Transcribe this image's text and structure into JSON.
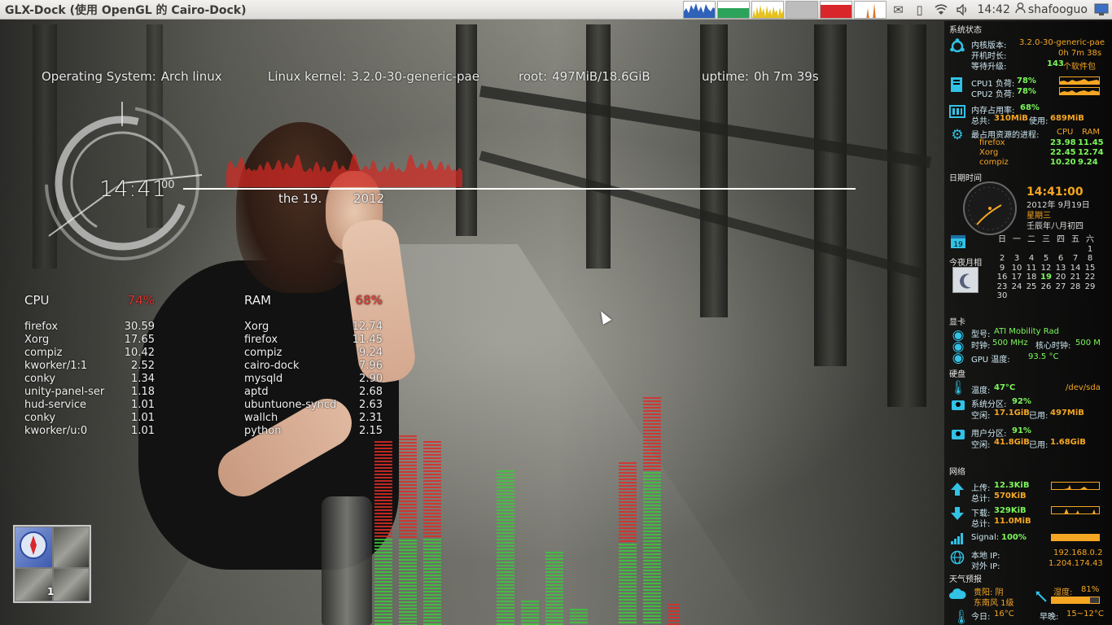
{
  "panel": {
    "title": "GLX-Dock (使用 OpenGL 的 Cairo-Dock)",
    "clock": "14:42",
    "user": "shafooguo"
  },
  "info": {
    "os_label": "Operating System:",
    "os_value": "Arch linux",
    "kernel_label": "Linux kernel:",
    "kernel_value": "3.2.0-30-generic-pae",
    "root_label": "root:",
    "root_value": "497MiB/18.6GiB",
    "uptime_label": "uptime:",
    "uptime_value": "0h 7m 39s"
  },
  "clock_widget": {
    "time": "14:41",
    "seconds": "00",
    "date": "the 19.",
    "year": "2012"
  },
  "cpu_table": {
    "title": "CPU",
    "percent": "74%",
    "rows": [
      {
        "name": "firefox",
        "value": "30.59"
      },
      {
        "name": "Xorg",
        "value": "17.65"
      },
      {
        "name": "compiz",
        "value": "10.42"
      },
      {
        "name": "kworker/1:1",
        "value": "2.52"
      },
      {
        "name": "conky",
        "value": "1.34"
      },
      {
        "name": "unity-panel-ser",
        "value": "1.18"
      },
      {
        "name": "hud-service",
        "value": "1.01"
      },
      {
        "name": "conky",
        "value": "1.01"
      },
      {
        "name": "kworker/u:0",
        "value": "1.01"
      }
    ]
  },
  "ram_table": {
    "title": "RAM",
    "percent": "68%",
    "rows": [
      {
        "name": "Xorg",
        "value": "12.74"
      },
      {
        "name": "firefox",
        "value": "11.45"
      },
      {
        "name": "compiz",
        "value": "9.24"
      },
      {
        "name": "cairo-dock",
        "value": "7.96"
      },
      {
        "name": "mysqld",
        "value": "2.90"
      },
      {
        "name": "aptd",
        "value": "2.68"
      },
      {
        "name": "ubuntuone-syncd",
        "value": "2.63"
      },
      {
        "name": "wallch",
        "value": "2.31"
      },
      {
        "name": "python",
        "value": "2.15"
      }
    ]
  },
  "workspace": {
    "number": "1"
  },
  "right": {
    "sys_title": "系统状态",
    "kernel_label": "内核版本:",
    "kernel_value": "3.2.0-30-generic-pae",
    "boot_label": "开机时长:",
    "boot_value": "0h 7m 38s",
    "upgrade_label": "等待升级:",
    "upgrade_count": "143",
    "upgrade_unit": "个软件包",
    "cpu1_label": "CPU1 负荷:",
    "cpu1_value": "78%",
    "cpu2_label": "CPU2 负荷:",
    "cpu2_value": "78%",
    "mem_label": "内存占用率:",
    "mem_value": "68%",
    "mem_total_label": "总共:",
    "mem_total_value": "310MiB",
    "mem_used_label": "使用:",
    "mem_used_value": "689MiB",
    "top_label": "最占用资源的进程:",
    "top_cpu": "CPU",
    "top_ram": "RAM",
    "top_rows": [
      {
        "name": "firefox",
        "cpu": "23.98",
        "ram": "11.45"
      },
      {
        "name": "Xorg",
        "cpu": "22.45",
        "ram": "12.74"
      },
      {
        "name": "compiz",
        "cpu": "10.20",
        "ram": "9.24"
      }
    ],
    "date_title": "日期时间",
    "clock_time": "14:41:00",
    "clock_date": "2012年 9月19日",
    "clock_weekday": "星期三",
    "clock_lunar": "壬辰年八月初四",
    "cal_header": [
      "日",
      "一",
      "二",
      "三",
      "四",
      "五",
      "六"
    ],
    "cal_rows": [
      [
        "",
        "",
        "",
        "",
        "",
        "",
        "1"
      ],
      [
        "2",
        "3",
        "4",
        "5",
        "6",
        "7",
        "8"
      ],
      [
        "9",
        "10",
        "11",
        "12",
        "13",
        "14",
        "15"
      ],
      [
        "16",
        "17",
        "18",
        "19",
        "20",
        "21",
        "22"
      ],
      [
        "23",
        "24",
        "25",
        "26",
        "27",
        "28",
        "29"
      ],
      [
        "30",
        "",
        "",
        "",
        "",
        "",
        ""
      ]
    ],
    "cal_today": "19",
    "cal_icon_day": "19",
    "moon_title": "今夜月相",
    "gpu_title": "显卡",
    "gpu_model_label": "型号:",
    "gpu_model_value": "ATI Mobility Rad",
    "gpu_clock_label": "时钟:",
    "gpu_clock_value": "500 MHz",
    "gpu_core_label": "核心时钟:",
    "gpu_core_value": "500 M",
    "gpu_temp_label": "GPU 温度:",
    "gpu_temp_value": "93.5 °C",
    "disk_title": "硬盘",
    "disk_temp_label": "温度:",
    "disk_temp_value": "47°C",
    "disk_dev": "/dev/sda",
    "sys_part_label": "系统分区:",
    "sys_part_value": "92%",
    "sys_free_label": "空闲:",
    "sys_free_value": "17.1GiB",
    "sys_used_label": "已用:",
    "sys_used_value": "497MiB",
    "user_part_label": "用户分区:",
    "user_part_value": "91%",
    "user_free_label": "空闲:",
    "user_free_value": "41.8GiB",
    "user_used_label": "已用:",
    "user_used_value": "1.68GiB",
    "net_title": "网络",
    "up_label": "上传:",
    "up_value": "12.3KiB",
    "up_total_label": "总计:",
    "up_total_value": "570KiB",
    "down_label": "下载:",
    "down_value": "329KiB",
    "down_total_label": "总计:",
    "down_total_value": "11.0MiB",
    "signal_label": "Signal:",
    "signal_value": "100%",
    "local_ip_label": "本地 IP:",
    "local_ip_value": "192.168.0.2",
    "ext_ip_label": "对外 IP:",
    "ext_ip_value": "1.204.174.43",
    "weather_title": "天气预报",
    "w_city": "贵阳: 阴",
    "w_wind": "东南风 1级",
    "w_humidity_label": "湿度:",
    "w_humidity_value": "81%",
    "w_today_label": "今日:",
    "w_today_value": "16°C",
    "w_range_label": "早晚:",
    "w_range_value": "15~12°C"
  },
  "colors": {
    "accent_green": "#7cf75a",
    "accent_orange": "#f5a623",
    "accent_cyan": "#31c2e6",
    "accent_red": "#e0322a"
  },
  "icons": [
    "network-icon",
    "speaker-icon",
    "mail-icon",
    "battery-icon",
    "user-icon",
    "ubuntu-icon",
    "cpu-icon",
    "memory-icon",
    "gear-icon",
    "clock-icon",
    "calendar-icon",
    "moon-icon",
    "gpu-icon",
    "thermometer-icon",
    "disk-icon",
    "upload-icon",
    "download-icon",
    "signal-icon",
    "globe-icon",
    "cloud-icon",
    "wind-icon"
  ]
}
